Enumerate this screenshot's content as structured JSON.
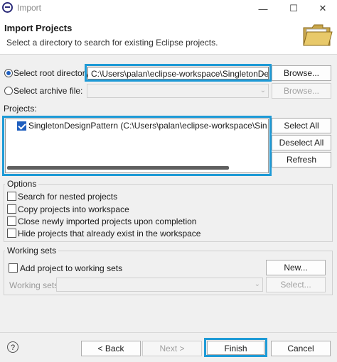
{
  "window": {
    "title": "Import",
    "minimize_glyph": "—",
    "maximize_glyph": "☐",
    "close_glyph": "✕"
  },
  "header": {
    "title": "Import Projects",
    "description": "Select a directory to search for existing Eclipse projects."
  },
  "source": {
    "root_directory_label": "Select root directory:",
    "root_directory_value": "C:\\Users\\palan\\eclipse-workspace\\SingletonDesign",
    "root_directory_selected": true,
    "browse_label": "Browse...",
    "archive_file_label": "Select archive file:",
    "archive_file_value": "",
    "archive_browse_label": "Browse..."
  },
  "projects": {
    "label": "Projects:",
    "items": [
      {
        "label": "SingletonDesignPattern (C:\\Users\\palan\\eclipse-workspace\\SingletonDesi",
        "checked": true
      }
    ],
    "select_all_label": "Select All",
    "deselect_all_label": "Deselect All",
    "refresh_label": "Refresh"
  },
  "options": {
    "title": "Options",
    "items": [
      {
        "label": "Search for nested projects",
        "checked": false
      },
      {
        "label": "Copy projects into workspace",
        "checked": false
      },
      {
        "label": "Close newly imported projects upon completion",
        "checked": false
      },
      {
        "label": "Hide projects that already exist in the workspace",
        "checked": false
      }
    ]
  },
  "working_sets": {
    "title": "Working sets",
    "add_label": "Add project to working sets",
    "add_checked": false,
    "new_label": "New...",
    "sets_label": "Working sets:",
    "sets_value": "",
    "select_label": "Select..."
  },
  "footer": {
    "help_glyph": "?",
    "back_label": "< Back",
    "next_label": "Next >",
    "finish_label": "Finish",
    "cancel_label": "Cancel"
  },
  "colors": {
    "highlight": "#1e9ad6",
    "accent": "#1f5fbf"
  }
}
